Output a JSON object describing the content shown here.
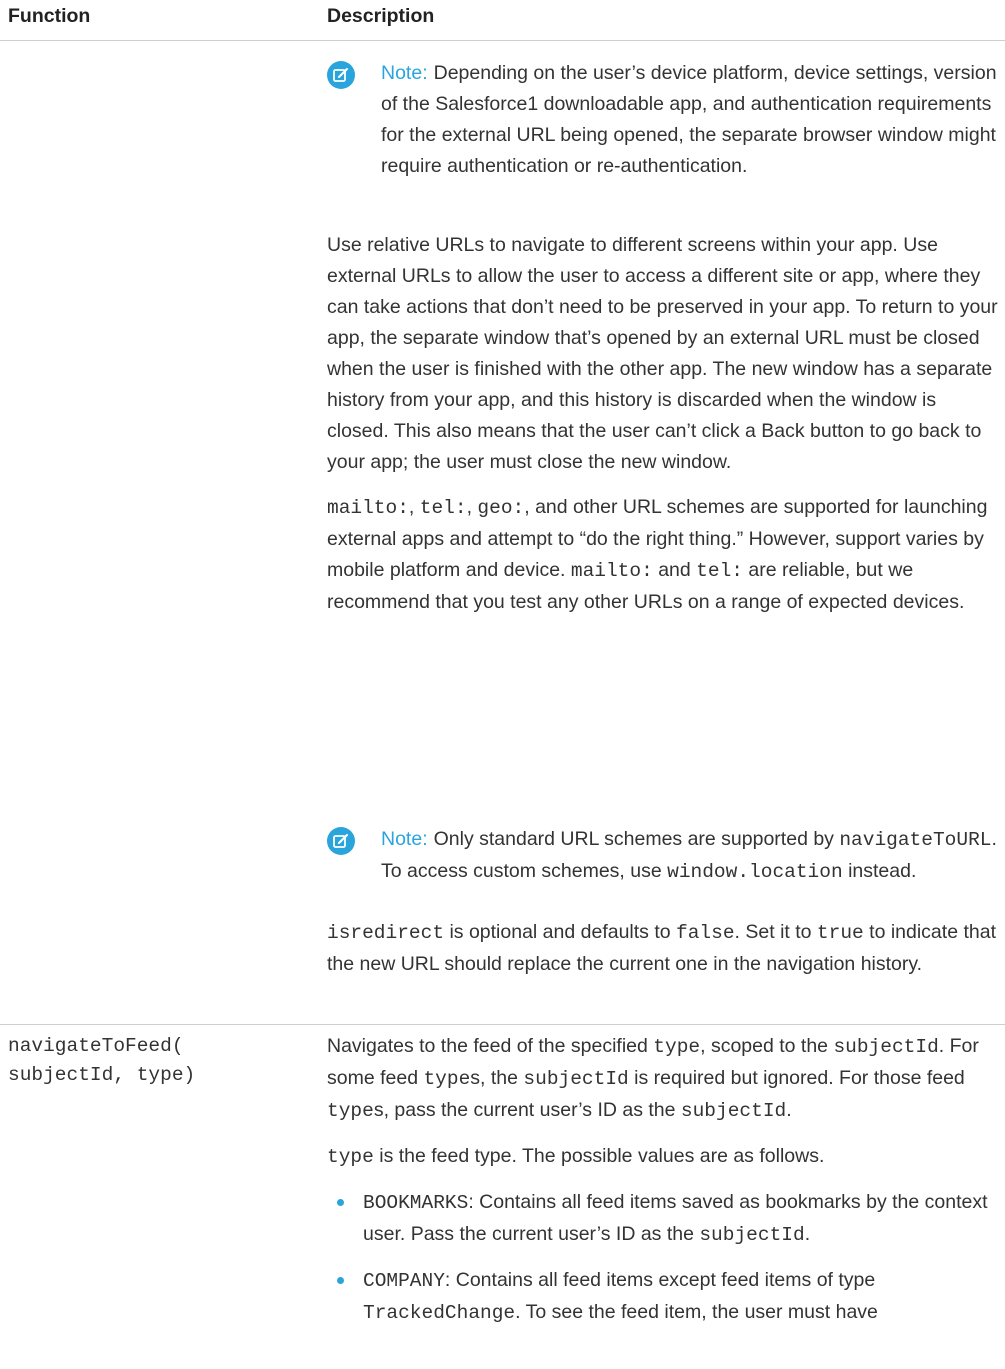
{
  "header": {
    "function": "Function",
    "description": "Description"
  },
  "note1": {
    "label": "Note:",
    "text": "Depending on the user’s device platform, device settings, version of the Salesforce1 downloadable app, and authentication requirements for the external URL being opened, the separate browser window might require authentication or re-authentication."
  },
  "para_relative": "Use relative URLs to navigate to different screens within your app. Use external URLs to allow the user to access a different site or app, where they can take actions that don’t need to be preserved in your app. To return to your app, the separate window that’s opened by an external URL must be closed when the user is finished with the other app. The new window has a separate history from your app, and this history is discarded when the window is closed. This also means that the user can’t click a Back button to go back to your app; the user must close the new window.",
  "para_schemes": {
    "mailto": "mailto:",
    "sep1": ", ",
    "tel": "tel:",
    "sep2": ", ",
    "geo": "geo:",
    "text1": ", and other URL schemes are supported for launching external apps and attempt to “do the right thing.” However, support varies by mobile platform and device. ",
    "mailto2": "mailto:",
    "and": " and ",
    "tel2": "tel:",
    "text2": " are reliable, but we recommend that you test any other URLs on a range of expected devices."
  },
  "note2": {
    "label": "Note:",
    "text1": "Only standard URL schemes are supported by ",
    "code1": "navigateToURL",
    "text2": ". To access custom schemes, use ",
    "code2": "window.location",
    "text3": " instead."
  },
  "para_redirect": {
    "code1": "isredirect",
    "text1": " is optional and defaults to ",
    "code2": "false",
    "text2": ". Set it to ",
    "code3": "true",
    "text3": " to indicate that the new URL should replace the current one in the navigation history."
  },
  "row2": {
    "function_line1": "navigateToFeed(",
    "function_line2": "subjectId, type)",
    "p1": {
      "t1": "Navigates to the feed of the specified ",
      "c1": "type",
      "t2": ", scoped to the ",
      "c2": "subjectId",
      "t3": ". For some feed ",
      "c3": "type",
      "t4": "s, the ",
      "c4": "subjectId",
      "t5": " is required but ignored. For those feed ",
      "c5": "type",
      "t6": "s, pass the current user’s ID as the ",
      "c6": "subjectId",
      "t7": "."
    },
    "p2": {
      "c1": "type",
      "t1": " is the feed type. The possible values are as follows."
    },
    "bullets": [
      {
        "code": "BOOKMARKS",
        "text": ": Contains all feed items saved as bookmarks by the context user. Pass the current user’s ID as the ",
        "code2": "subjectId",
        "text2": "."
      },
      {
        "code": "COMPANY",
        "text": ": Contains all feed items except feed items of type ",
        "code2": "TrackedChange",
        "text2": ". To see the feed item, the user must have"
      }
    ]
  }
}
